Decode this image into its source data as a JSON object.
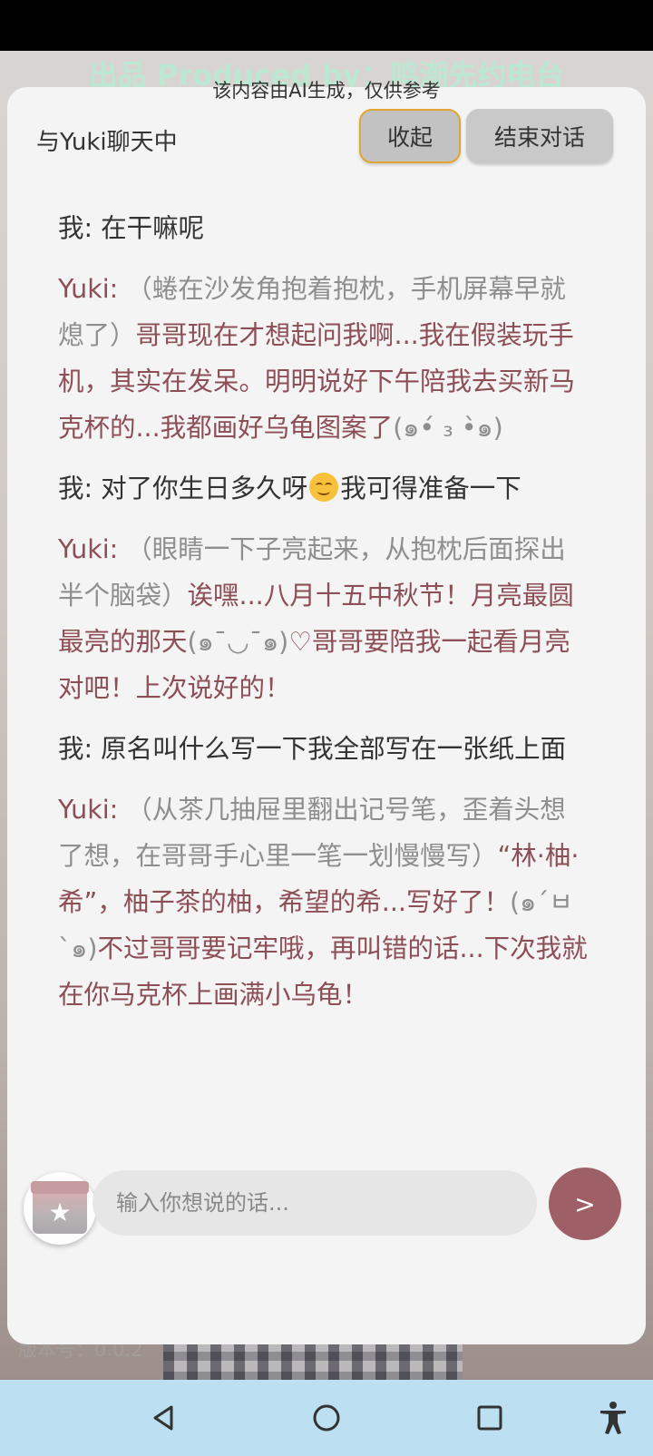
{
  "watermark": {
    "credit": "出品 Produced by：鸣潮先约电台",
    "ai_note": "该内容由AI生成，仅供参考",
    "version": "版本号：0.0.2"
  },
  "header": {
    "title": "与Yuki聊天中",
    "collapse_label": "收起",
    "end_label": "结束对话"
  },
  "messages": [
    {
      "role": "user",
      "prefix": "我: ",
      "text": "在干嘛呢"
    },
    {
      "role": "bot",
      "speaker": "Yuki: ",
      "action": "（蜷在沙发角抱着抱枕，手机屏幕早就熄了）",
      "speech": "哥哥现在才想起问我啊...我在假装玩手机，其实在发呆。明明说好下午陪我去买新马克杯的...我都画好乌龟图案了",
      "kaomoji": "(๑•́ ₃ •̀๑)"
    },
    {
      "role": "user",
      "prefix": "我: ",
      "text_before": "对了你生日多久呀",
      "emoji": "smiling-face-emoji",
      "text_after": "我可得准备一下"
    },
    {
      "role": "bot",
      "speaker": "Yuki: ",
      "action": "（眼睛一下子亮起来，从抱枕后面探出半个脑袋）",
      "speech": "诶嘿...八月十五中秋节！月亮最圆最亮的那天",
      "kaomoji": "(๑¯◡¯๑)",
      "speech2": "♡哥哥要陪我一起看月亮对吧！上次说好的！"
    },
    {
      "role": "user",
      "prefix": "我: ",
      "text": "原名叫什么写一下我全部写在一张纸上面"
    },
    {
      "role": "bot",
      "speaker": "Yuki: ",
      "action": "（从茶几抽屉里翻出记号笔，歪着头想了想，在哥哥手心里一笔一划慢慢写）",
      "speech": "“林·柚·希”，柚子茶的柚，希望的希...写好了！",
      "kaomoji": "(๑´ㅂ`๑)",
      "speech2": "不过哥哥要记牢哦，再叫错的话...下次我就在你马克杯上画满小乌龟！"
    }
  ],
  "input": {
    "placeholder": "输入你想说的话...",
    "send_label": ">"
  },
  "colors": {
    "speaker": "#8d4e55",
    "action": "#8e8e8e",
    "send_button": "#9f5f66",
    "navbar": "#bcdff2"
  },
  "navbar": {
    "items": [
      "back-icon",
      "home-icon",
      "recents-icon",
      "accessibility-icon"
    ]
  }
}
